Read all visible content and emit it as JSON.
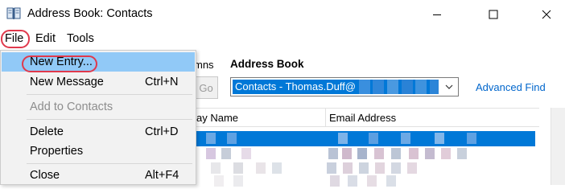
{
  "window": {
    "title": "Address Book: Contacts",
    "controls": {
      "minimize": "minimize",
      "maximize": "maximize",
      "close": "close"
    }
  },
  "menubar": {
    "file": "File",
    "edit": "Edit",
    "tools": "Tools"
  },
  "file_menu": {
    "items": [
      {
        "label": "New Entry...",
        "shortcut": "",
        "state": "highlighted"
      },
      {
        "label": "New Message",
        "shortcut": "Ctrl+N",
        "state": "normal"
      },
      {
        "label": "Add to Contacts",
        "shortcut": "",
        "state": "disabled"
      },
      {
        "label": "Delete",
        "shortcut": "Ctrl+D",
        "state": "normal"
      },
      {
        "label": "Properties",
        "shortcut": "",
        "state": "normal"
      },
      {
        "label": "Close",
        "shortcut": "Alt+F4",
        "state": "normal"
      }
    ]
  },
  "search": {
    "columns_label_fragment": "mns",
    "go_label": "Go",
    "address_book_label": "Address Book",
    "address_book_value": "Contacts - Thomas.Duff@",
    "advanced_find": "Advanced Find"
  },
  "list": {
    "columns": [
      "ay Name",
      "Email Address"
    ]
  },
  "colors": {
    "accent": "#0078d7",
    "menu_hover": "#91c9f7",
    "annotation": "#e0394c",
    "link": "#0066cc"
  },
  "icons": {
    "app": "address-book-icon",
    "dropdown": "chevron-down-icon"
  }
}
